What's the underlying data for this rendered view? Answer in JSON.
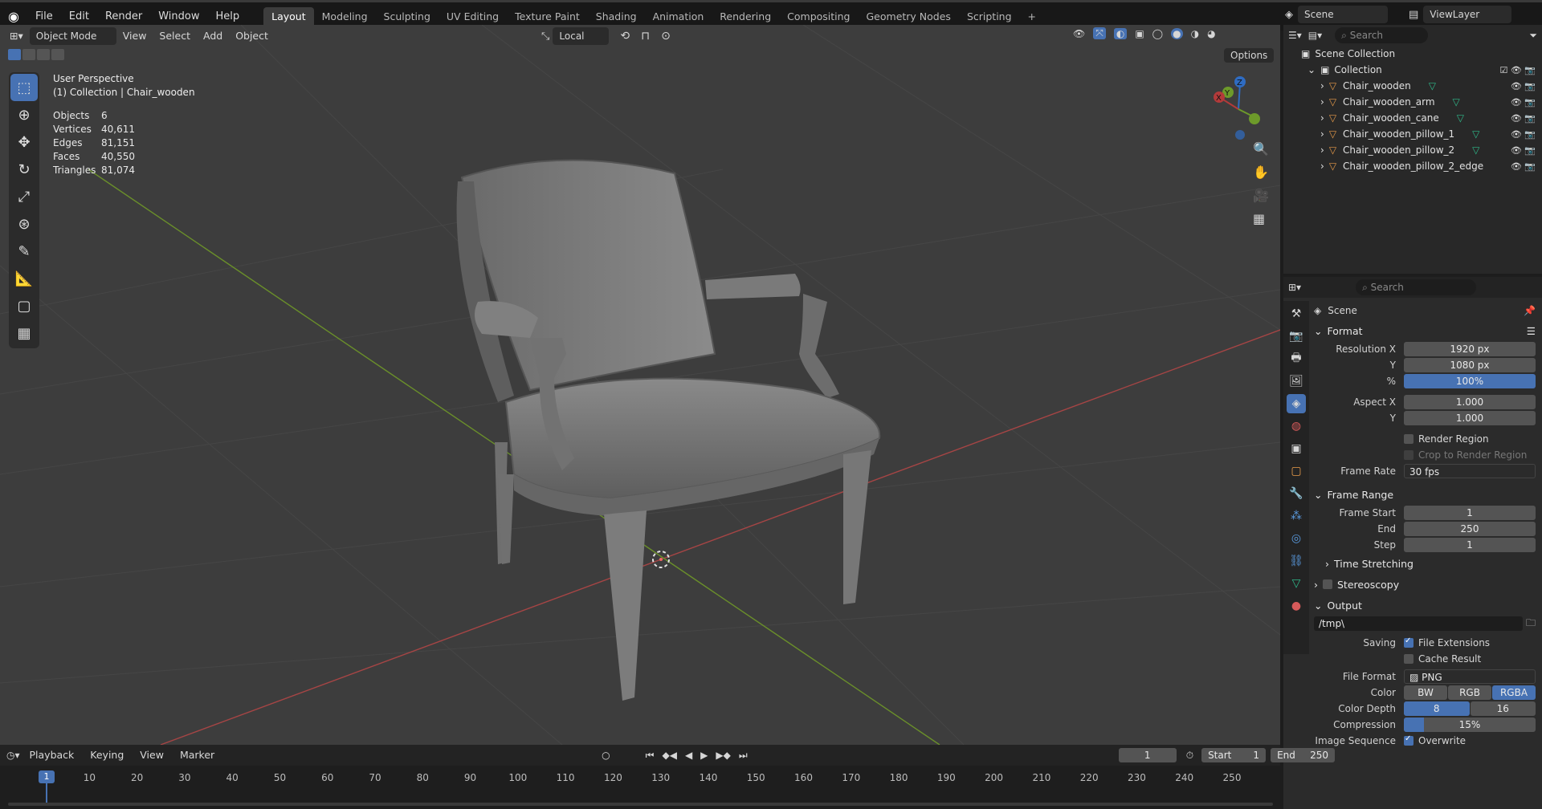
{
  "topbar": {
    "menus": [
      "File",
      "Edit",
      "Render",
      "Window",
      "Help"
    ],
    "workspaces": [
      "Layout",
      "Modeling",
      "Sculpting",
      "UV Editing",
      "Texture Paint",
      "Shading",
      "Animation",
      "Rendering",
      "Compositing",
      "Geometry Nodes",
      "Scripting"
    ],
    "active_workspace": "Layout",
    "scene": "Scene",
    "view_layer": "ViewLayer"
  },
  "viewport_header": {
    "mode": "Object Mode",
    "menus": [
      "View",
      "Select",
      "Add",
      "Object"
    ],
    "transform_orientation": "Local",
    "options": "Options"
  },
  "overlay": {
    "perspective": "User Perspective",
    "collection": "(1) Collection | Chair_wooden",
    "stats": [
      {
        "label": "Objects",
        "value": "6"
      },
      {
        "label": "Vertices",
        "value": "40,611"
      },
      {
        "label": "Edges",
        "value": "81,151"
      },
      {
        "label": "Faces",
        "value": "40,550"
      },
      {
        "label": "Triangles",
        "value": "81,074"
      }
    ]
  },
  "gizmo": {
    "x": "X",
    "y": "Y",
    "z": "Z"
  },
  "outliner": {
    "search_placeholder": "Search",
    "scene_collection": "Scene Collection",
    "collection": "Collection",
    "objects": [
      "Chair_wooden",
      "Chair_wooden_arm",
      "Chair_wooden_cane",
      "Chair_wooden_pillow_1",
      "Chair_wooden_pillow_2",
      "Chair_wooden_pillow_2_edge"
    ]
  },
  "properties": {
    "search_placeholder": "Search",
    "context": "Scene",
    "format": {
      "title": "Format",
      "res_x_label": "Resolution X",
      "res_x": "1920 px",
      "res_y_label": "Y",
      "res_y": "1080 px",
      "pct_label": "%",
      "pct": "100%",
      "aspect_x_label": "Aspect X",
      "aspect_x": "1.000",
      "aspect_y_label": "Y",
      "aspect_y": "1.000",
      "render_region": "Render Region",
      "crop": "Crop to Render Region",
      "frame_rate_label": "Frame Rate",
      "frame_rate": "30 fps"
    },
    "frame_range": {
      "title": "Frame Range",
      "start_label": "Frame Start",
      "start": "1",
      "end_label": "End",
      "end": "250",
      "step_label": "Step",
      "step": "1",
      "time_stretching": "Time Stretching"
    },
    "stereoscopy": "Stereoscopy",
    "output": {
      "title": "Output",
      "path": "/tmp\\",
      "saving_label": "Saving",
      "file_extensions": "File Extensions",
      "cache_result": "Cache Result",
      "file_format_label": "File Format",
      "file_format": "PNG",
      "color_label": "Color",
      "color_options": [
        "BW",
        "RGB",
        "RGBA"
      ],
      "color_selected": "RGBA",
      "depth_label": "Color Depth",
      "depth_options": [
        "8",
        "16"
      ],
      "depth_selected": "8",
      "compression_label": "Compression",
      "compression": "15%",
      "compression_fraction": 0.15,
      "sequence_label": "Image Sequence",
      "overwrite": "Overwrite"
    }
  },
  "timeline": {
    "menus": [
      "Playback",
      "Keying",
      "View",
      "Marker"
    ],
    "current_frame": "1",
    "start_label": "Start",
    "start": "1",
    "end_label": "End",
    "end": "250",
    "ticks": [
      "1",
      "10",
      "20",
      "30",
      "40",
      "50",
      "60",
      "70",
      "80",
      "90",
      "100",
      "110",
      "120",
      "130",
      "140",
      "150",
      "160",
      "170",
      "180",
      "190",
      "200",
      "210",
      "220",
      "230",
      "240",
      "250"
    ]
  },
  "colors": {
    "accent": "#4772b3",
    "x_axis": "#b33a3a",
    "y_axis": "#6d9a2a",
    "z_axis": "#2f6cc2"
  }
}
